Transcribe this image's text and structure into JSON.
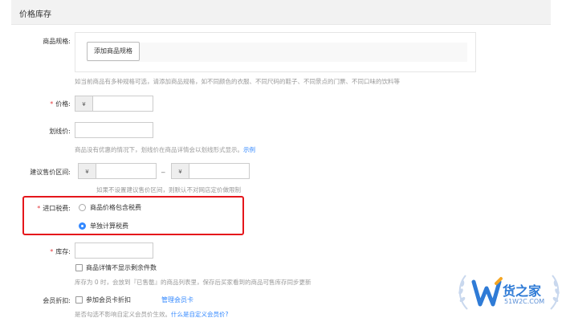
{
  "section": {
    "title": "价格库存"
  },
  "spec": {
    "label": "商品规格",
    "add_button": "添加商品规格",
    "help": "如当前商品有多种规格可选，请添加商品规格，如不同颜色的衣服、不同尺码的鞋子、不同景点的门票、不同口味的饮料等"
  },
  "price": {
    "required": "*",
    "label": "价格",
    "currency": "¥"
  },
  "list_price": {
    "label": "划线价",
    "help": "商品没有优惠的情况下，划线价在商品详情会以划线形式显示。",
    "help_link": "示例"
  },
  "suggested": {
    "label": "建议售价区间",
    "currency": "¥",
    "separator": "_",
    "help": "如果不设置建议售价区间，则默认不对网店定价做限制"
  },
  "import_tax": {
    "required": "*",
    "label": "进口税费",
    "option_included": "商品价格包含税费",
    "option_separate": "单独计算税费",
    "selected": "单独计算税费"
  },
  "stock": {
    "required": "*",
    "label": "库存",
    "hide_remaining_label": "商品详情不显示剩余件数",
    "help": "库存为 0 时，会放到『已售罄』的商品列表里，保存后买家看到的商品可售库存同步更新"
  },
  "member_discount": {
    "label": "会员折扣",
    "checkbox_label": "参加会员卡折扣",
    "manage_link": "管理会员卡",
    "help": "是否勾选不影响自定义会员价生效。",
    "help_link": "什么是自定义会员价?"
  },
  "watermark": {
    "brand": "货之家",
    "url": "51W2C.COM",
    "accent": "#2f7bd6"
  }
}
